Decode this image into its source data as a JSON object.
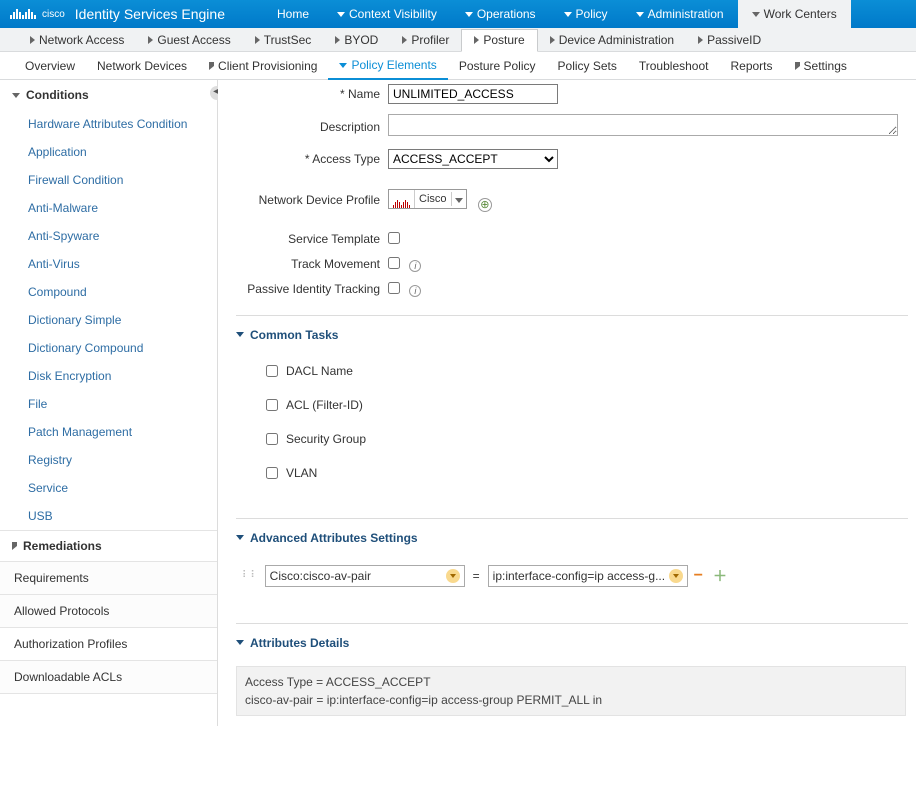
{
  "header": {
    "logo_text": "cisco",
    "product_title": "Identity Services Engine",
    "nav": [
      {
        "label": "Home",
        "dd": false
      },
      {
        "label": "Context Visibility",
        "dd": true
      },
      {
        "label": "Operations",
        "dd": true
      },
      {
        "label": "Policy",
        "dd": true
      },
      {
        "label": "Administration",
        "dd": true
      },
      {
        "label": "Work Centers",
        "dd": true,
        "active": true
      }
    ]
  },
  "subnav1": [
    {
      "label": "Network Access",
      "dd": true
    },
    {
      "label": "Guest Access",
      "dd": true
    },
    {
      "label": "TrustSec",
      "dd": true
    },
    {
      "label": "BYOD",
      "dd": true
    },
    {
      "label": "Profiler",
      "dd": true
    },
    {
      "label": "Posture",
      "dd": true,
      "active": true
    },
    {
      "label": "Device Administration",
      "dd": true
    },
    {
      "label": "PassiveID",
      "dd": true
    }
  ],
  "subnav2": [
    {
      "label": "Overview"
    },
    {
      "label": "Network Devices"
    },
    {
      "label": "Client Provisioning",
      "dd": true
    },
    {
      "label": "Policy Elements",
      "dd": true,
      "active": true
    },
    {
      "label": "Posture Policy"
    },
    {
      "label": "Policy Sets"
    },
    {
      "label": "Troubleshoot"
    },
    {
      "label": "Reports"
    },
    {
      "label": "Settings",
      "dd": true
    }
  ],
  "sidebar": {
    "conditions_title": "Conditions",
    "conditions_items": [
      {
        "label": "Hardware Attributes Condition"
      },
      {
        "label": "Application"
      },
      {
        "label": "Firewall Condition"
      },
      {
        "label": "Anti-Malware"
      },
      {
        "label": "Anti-Spyware"
      },
      {
        "label": "Anti-Virus"
      },
      {
        "label": "Compound"
      },
      {
        "label": "Dictionary Simple"
      },
      {
        "label": "Dictionary Compound"
      },
      {
        "label": "Disk Encryption"
      },
      {
        "label": "File"
      },
      {
        "label": "Patch Management"
      },
      {
        "label": "Registry"
      },
      {
        "label": "Service"
      },
      {
        "label": "USB"
      }
    ],
    "remediations_title": "Remediations",
    "singles": [
      {
        "label": "Requirements"
      },
      {
        "label": "Allowed Protocols"
      },
      {
        "label": "Authorization Profiles",
        "active": true
      },
      {
        "label": "Downloadable ACLs"
      }
    ]
  },
  "form": {
    "name_label": "Name",
    "name_value": "UNLIMITED_ACCESS",
    "desc_label": "Description",
    "desc_value": "",
    "access_type_label": "Access Type",
    "access_type_value": "ACCESS_ACCEPT",
    "ndp_label": "Network Device Profile",
    "ndp_value": "Cisco",
    "svc_tmpl_label": "Service Template",
    "track_label": "Track Movement",
    "passive_label": "Passive Identity Tracking"
  },
  "common_tasks": {
    "title": "Common Tasks",
    "items": [
      {
        "label": "DACL Name"
      },
      {
        "label": "ACL  (Filter-ID)"
      },
      {
        "label": "Security Group"
      },
      {
        "label": "VLAN"
      }
    ]
  },
  "advanced": {
    "title": "Advanced Attributes Settings",
    "attr_name": "Cisco:cisco-av-pair",
    "attr_value": "ip:interface-config=ip access-g..."
  },
  "details": {
    "title": "Attributes Details",
    "line1": "Access Type = ACCESS_ACCEPT",
    "line2": "cisco-av-pair = ip:interface-config=ip access-group PERMIT_ALL in"
  }
}
